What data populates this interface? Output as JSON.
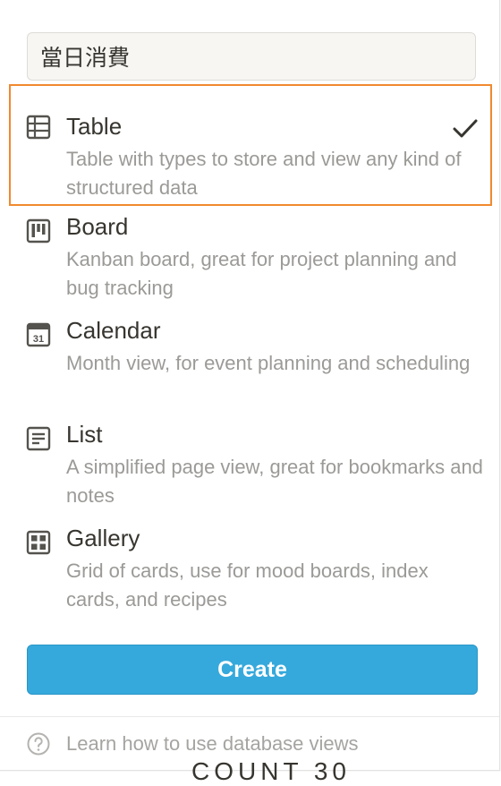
{
  "view_name": {
    "value": "當日消費"
  },
  "options": [
    {
      "title": "Table",
      "desc": "Table with types to store and view any kind of structured data",
      "icon": "table-icon",
      "selected": true
    },
    {
      "title": "Board",
      "desc": "Kanban board, great for project planning and bug tracking",
      "icon": "board-icon"
    },
    {
      "title": "Calendar",
      "desc": "Month view, for event planning and scheduling",
      "icon": "calendar-icon",
      "icon_text": "31"
    },
    {
      "title": "List",
      "desc": "A simplified page view, great for bookmarks and notes",
      "icon": "list-icon"
    },
    {
      "title": "Gallery",
      "desc": "Grid of cards, use for mood boards, index cards, and recipes",
      "icon": "gallery-icon"
    }
  ],
  "create_label": "Create",
  "help_label": "Learn how to use database views",
  "background_text": "COUNT 30",
  "colors": {
    "accent": "#35a9dc",
    "selection_outline": "#f0892e",
    "text": "#37352f",
    "muted": "#9b9a97"
  }
}
